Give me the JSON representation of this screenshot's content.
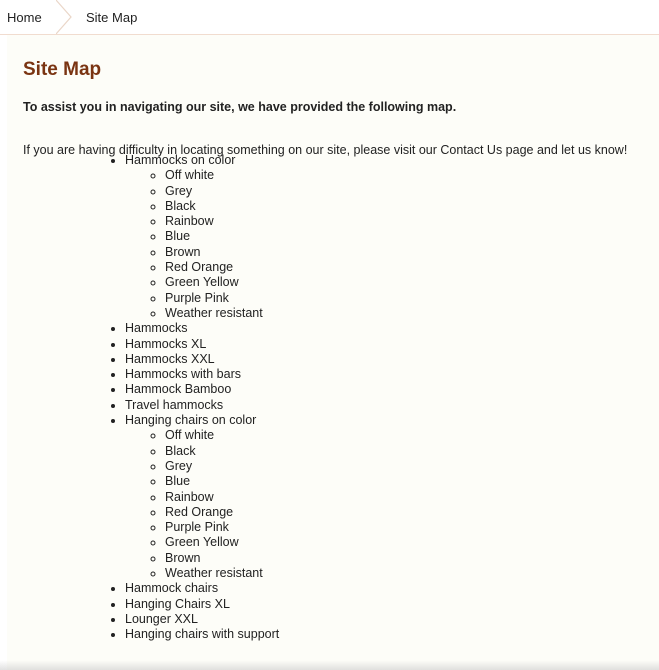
{
  "breadcrumb": {
    "home": "Home",
    "current": "Site Map"
  },
  "page": {
    "title": "Site Map",
    "intro_bold": "To assist you in navigating our site, we have provided the following map.",
    "help_before": "If you are having difficulty in locating something on our site, please visit our ",
    "help_link": "Contact Us",
    "help_after": " page and let us know!"
  },
  "sitemap": [
    {
      "label": "Hammocks on color",
      "children": [
        "Off white",
        "Grey",
        "Black",
        "Rainbow",
        "Blue",
        "Brown",
        "Red Orange",
        "Green Yellow",
        "Purple Pink",
        "Weather resistant"
      ]
    },
    {
      "label": "Hammocks"
    },
    {
      "label": "Hammocks XL"
    },
    {
      "label": "Hammocks XXL"
    },
    {
      "label": "Hammocks with bars"
    },
    {
      "label": "Hammock Bamboo"
    },
    {
      "label": "Travel hammocks"
    },
    {
      "label": "Hanging chairs on color",
      "children": [
        "Off white",
        "Black",
        "Grey",
        "Blue",
        "Rainbow",
        "Red Orange",
        "Purple Pink",
        "Green Yellow",
        "Brown",
        "Weather resistant"
      ]
    },
    {
      "label": "Hammock chairs"
    },
    {
      "label": "Hanging Chairs XL"
    },
    {
      "label": "Lounger XXL"
    },
    {
      "label": "Hanging chairs with support"
    }
  ],
  "colors": {
    "title": "#7a3412",
    "content_bg": "#fdfdf8",
    "breadcrumb_border": "#f1dccf"
  }
}
